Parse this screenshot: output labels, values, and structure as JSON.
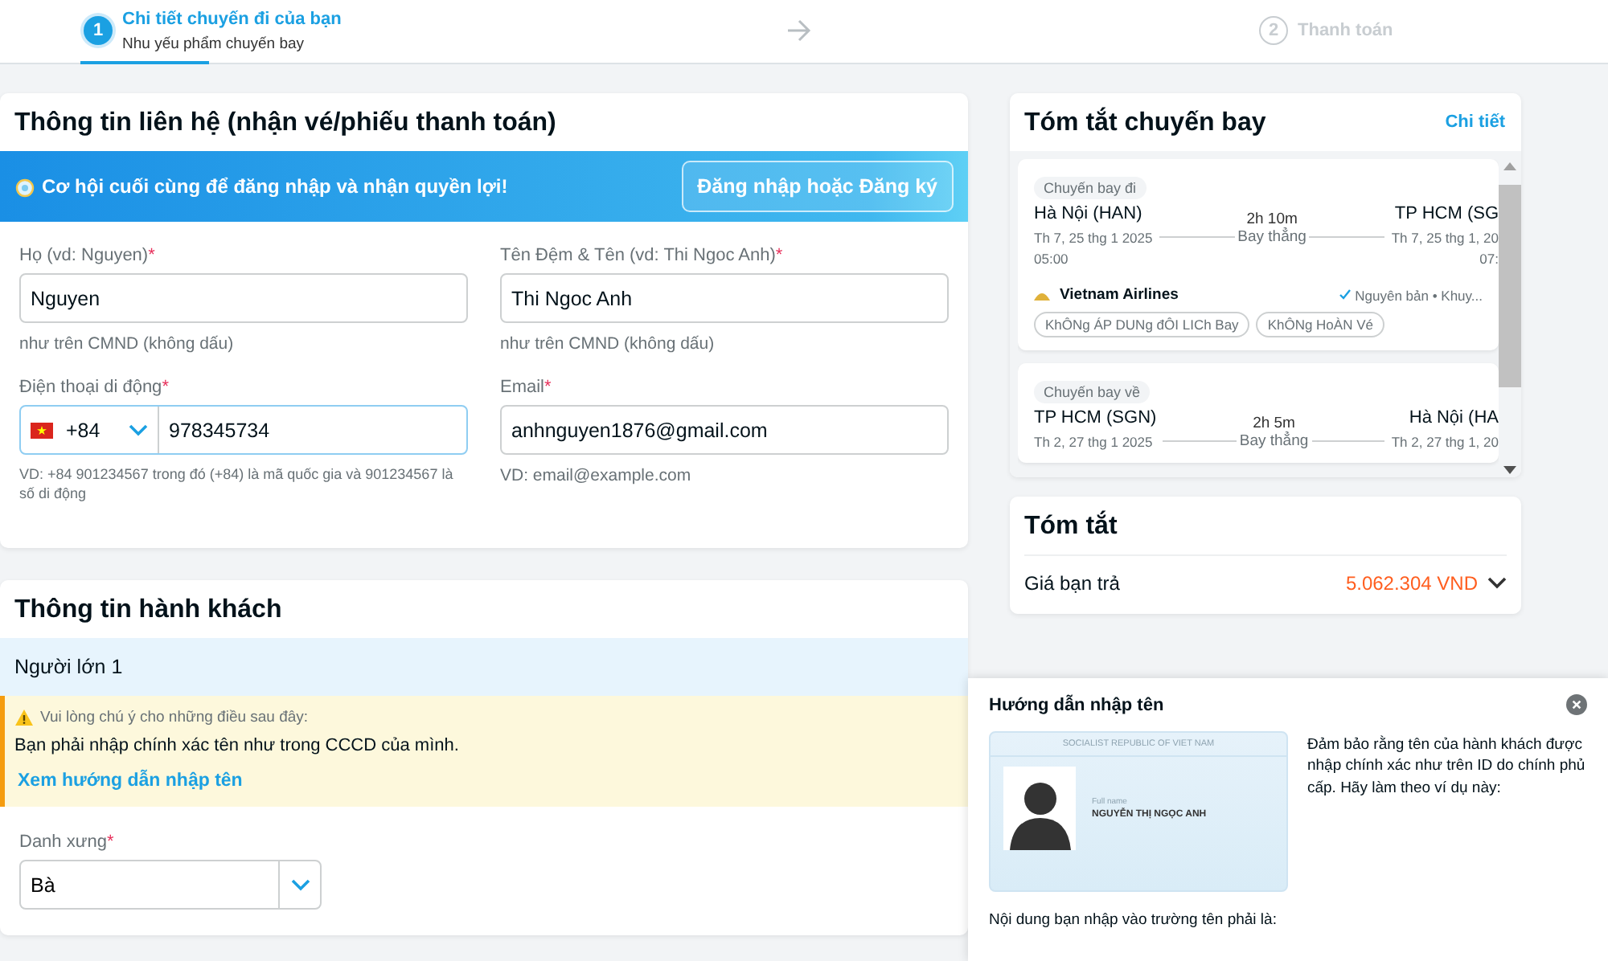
{
  "steps": [
    {
      "number": "1",
      "title": "Chi tiết chuyến đi của bạn",
      "subtitle": "Nhu yếu phẩm chuyến bay",
      "selected": true
    },
    {
      "number": "2",
      "title": "Thanh toán",
      "selected": false
    }
  ],
  "progress": {
    "level": 0.08
  },
  "contact": {
    "title": "Thông tin liên hệ (nhận vé/phiếu thanh toán)",
    "banner": {
      "text": "Cơ hội cuối cùng để đăng nhập và nhận quyền lợi!",
      "button": "Đăng nhập hoặc Đăng ký"
    },
    "fields": [
      {
        "label": "Họ (vd: Nguyen)",
        "required_mark": "*",
        "value": "Nguyen",
        "hint": "như trên CMND (không dấu)",
        "focused": false
      },
      {
        "label": "Tên Đệm & Tên (vd: Thi Ngoc Anh)",
        "required_mark": "*",
        "value": "Thi Ngoc Anh",
        "hint": "như trên CMND (không dấu)",
        "focused": false
      },
      {
        "label": "Điện thoại di động",
        "required_mark": "*",
        "kind": "phone",
        "country_code": "+84",
        "value": "978345734",
        "hint": "VD: +84 901234567 trong đó (+84) là mã quốc gia và 901234567 là số di động",
        "focused": true
      },
      {
        "label": "Email",
        "required_mark": "*",
        "value": "anhnguyen1876@gmail.com",
        "hint": "VD: email@example.com",
        "focused": false
      }
    ]
  },
  "passengers": {
    "title": "Thông tin hành khách",
    "group": "Người lớn 1",
    "notice": {
      "heading": "Vui lòng chú ý cho những điều sau đây:",
      "text": "Bạn phải nhập chính xác tên như trong CCCD của mình.",
      "link": "Xem hướng dẫn nhập tên"
    },
    "title_field": {
      "label": "Danh xưng",
      "required_mark": "*",
      "value": "Bà"
    }
  },
  "flight_summary": {
    "title": "Tóm tắt chuyến bay",
    "link": "Chi tiết",
    "flights": [
      {
        "tag": "Chuyến bay đi",
        "from": "Hà Nội (HAN)",
        "to": "TP HCM (SG",
        "duration": "2h 10m",
        "type": "Bay thẳng",
        "depart_date": "Th 7, 25 thg 1 2025",
        "arrive_date": "Th 7, 25 thg 1, 20",
        "depart_time": "05:00",
        "arrive_time": "07:",
        "airline": "Vietnam Airlines",
        "fare": "Nguyên bản • Khuy...",
        "badges": [
          "KhÔNg ÁP DUNg đÔI LICh Bay",
          "KhÔNg HoÀN Vé"
        ]
      },
      {
        "tag": "Chuyến bay về",
        "from": "TP HCM (SGN)",
        "to": "Hà Nội (HA",
        "duration": "2h 5m",
        "type": "Bay thẳng",
        "depart_date": "Th 2, 27 thg 1 2025",
        "arrive_date": "Th 2, 27 thg 1, 20"
      }
    ]
  },
  "price_summary": {
    "title": "Tóm tắt",
    "label": "Giá bạn trả",
    "amount": "5.062.304 VND"
  },
  "name_guide": {
    "title": "Hướng dẫn nhập tên",
    "card": {
      "country": "SOCIALIST REPUBLIC OF VIET NAM",
      "name_label": "Full name",
      "name": "NGUYỄN THỊ NGỌC ANH"
    },
    "text": "Đảm bảo rằng tên của hành khách được nhập chính xác như trên ID do chính phủ cấp. Hãy làm theo ví dụ này:",
    "footer": "Nội dung bạn nhập vào trường tên phải là:"
  }
}
